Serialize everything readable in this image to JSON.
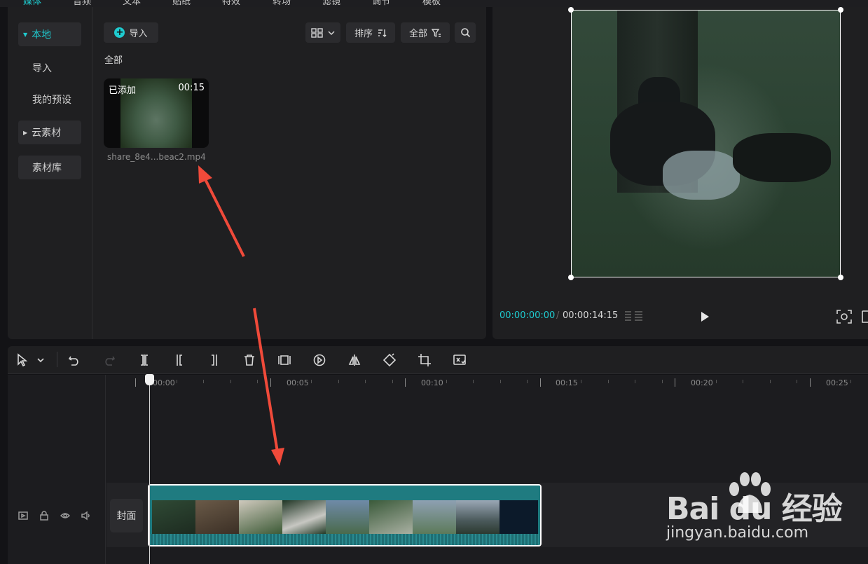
{
  "top_tabs": [
    {
      "label": "媒体",
      "active": true
    },
    {
      "label": "音频",
      "active": false
    },
    {
      "label": "文本",
      "active": false
    },
    {
      "label": "贴纸",
      "active": false
    },
    {
      "label": "特效",
      "active": false
    },
    {
      "label": "转场",
      "active": false
    },
    {
      "label": "滤镜",
      "active": false
    },
    {
      "label": "调节",
      "active": false
    },
    {
      "label": "模板",
      "active": false
    }
  ],
  "media_sidebar": {
    "items": [
      {
        "label": "本地",
        "active": true,
        "expandable": true
      },
      {
        "label": "导入",
        "active": false
      },
      {
        "label": "我的预设",
        "active": false
      },
      {
        "label": "云素材",
        "active": false,
        "expandable": true
      },
      {
        "label": "素材库",
        "active": false
      }
    ]
  },
  "media_toolbar": {
    "import_label": "导入",
    "sort_label": "排序",
    "filter_label": "全部"
  },
  "media_section_title": "全部",
  "media_item": {
    "status": "已添加",
    "duration": "00:15",
    "filename": "share_8e4...beac2.mp4"
  },
  "preview": {
    "time_current": "00:00:00:00",
    "time_separator": "/",
    "time_total": "00:00:14:15"
  },
  "timeline": {
    "ruler_labels": [
      "00:00",
      "00:05",
      "00:10",
      "00:15",
      "00:20",
      "00:25"
    ],
    "cover_label": "封面"
  },
  "watermark": {
    "brand": "Bai du 经验",
    "url": "jingyan.baidu.com"
  },
  "colors": {
    "accent": "#1fcbd0",
    "clip": "#1f7b80",
    "annotation_arrow": "#f04a3a"
  }
}
